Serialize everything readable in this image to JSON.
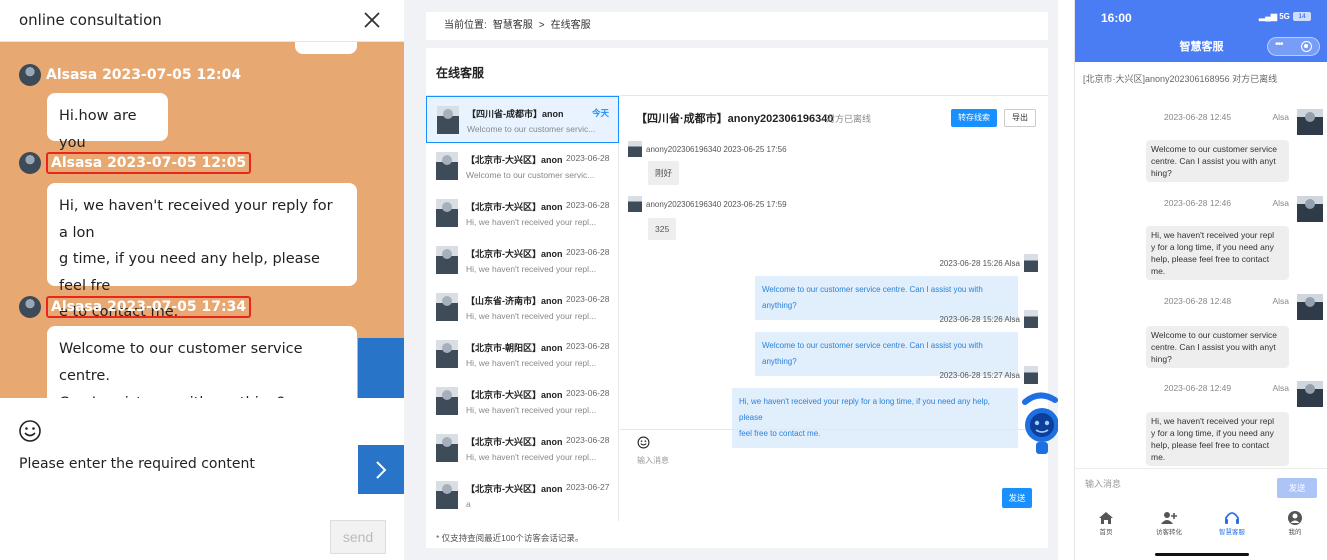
{
  "panel1": {
    "title": "online consultation",
    "messages": [
      {
        "meta": "Alsasa 2023-07-05 12:04",
        "text": "Hi.how are you"
      },
      {
        "meta": "Alsasa 2023-07-05 12:05",
        "text": "Hi, we haven't received your reply for a lon\ng time, if you need any help, please feel fre\ne to contact me."
      },
      {
        "meta": "Alsasa 2023-07-05 17:34",
        "text": "Welcome to our customer service centre.\nCan I assist you with anything?"
      }
    ],
    "input_placeholder": "Please enter the required content",
    "send_label": "send",
    "accent_color": "#2874c8",
    "highlight_color": "#e8261d"
  },
  "panel2": {
    "breadcrumb": {
      "prefix": "当前位置:",
      "parent": "智慧客服",
      "sep": ">",
      "current": "在线客服"
    },
    "section_title": "在线客服",
    "sessions": [
      {
        "loc": "【四川省-成都市】anon...",
        "date": "今天",
        "snippet": "Welcome to our customer servic..."
      },
      {
        "loc": "【北京市-大兴区】anon...",
        "date": "2023-06-28",
        "snippet": "Welcome to our customer servic..."
      },
      {
        "loc": "【北京市-大兴区】anon...",
        "date": "2023-06-28",
        "snippet": "Hi, we haven't received your repl..."
      },
      {
        "loc": "【北京市-大兴区】anon...",
        "date": "2023-06-28",
        "snippet": "Hi, we haven't received your repl..."
      },
      {
        "loc": "【山东省-济南市】anon...",
        "date": "2023-06-28",
        "snippet": "Hi, we haven't received your repl..."
      },
      {
        "loc": "【北京市-朝阳区】anon...",
        "date": "2023-06-28",
        "snippet": "Hi, we haven't received your repl..."
      },
      {
        "loc": "【北京市-大兴区】anon...",
        "date": "2023-06-28",
        "snippet": "Hi, we haven't received your repl..."
      },
      {
        "loc": "【北京市-大兴区】anon...",
        "date": "2023-06-28",
        "snippet": "Hi, we haven't received your repl..."
      },
      {
        "loc": "【北京市-大兴区】anon...",
        "date": "2023-06-27",
        "snippet": "a"
      }
    ],
    "chat_title": "【四川省·成都市】anony202306196340",
    "chat_status": "对方已离线",
    "save_label": "转存线索",
    "export_label": "导出",
    "visitor_msgs": [
      {
        "meta": "anony202306196340  2023-06-25 17:56",
        "text": "刚好"
      },
      {
        "meta": "anony202306196340  2023-06-25 17:59",
        "text": "325"
      }
    ],
    "agent_msgs": [
      {
        "meta": "2023-06-28 15:26  Alsa",
        "text": "Welcome to our customer service centre. Can I assist you with anything?"
      },
      {
        "meta": "2023-06-28 15:26  Alsa",
        "text": "Welcome to our customer service centre. Can I assist you with anything?"
      },
      {
        "meta": "2023-06-28 15:27  Alsa",
        "text": "Hi, we haven't received your reply for a long time, if you need any help, please\nfeel free to contact me."
      }
    ],
    "input_placeholder": "输入消息",
    "send_label": "发送",
    "footnote": "* 仅支持查阅最近100个访客会话记录。",
    "primary_color": "#1890ff"
  },
  "panel3": {
    "time": "16:00",
    "signal": "5G",
    "battery": "14",
    "app_title": "智慧客服",
    "header": "[北京市·大兴区]anony202306168956  对方已离线",
    "messages": [
      {
        "time": "2023-06-28 12:45",
        "name": "Alsa",
        "text": "Welcome to our customer service\ncentre. Can I assist you with anyt\nhing?"
      },
      {
        "time": "2023-06-28 12:46",
        "name": "Alsa",
        "text": "Hi, we haven't received your repl\ny for a long time, if you need any\nhelp, please feel free to contact\nme."
      },
      {
        "time": "2023-06-28 12:48",
        "name": "Alsa",
        "text": "Welcome to our customer service\ncentre. Can I assist you with anyt\nhing?"
      },
      {
        "time": "2023-06-28 12:49",
        "name": "Alsa",
        "text": "Hi, we haven't received your repl\ny for a long time, if you need any\nhelp, please feel free to contact\nme."
      }
    ],
    "input_placeholder": "输入消息",
    "send_label": "发送",
    "tabs": [
      "首页",
      "访客转化",
      "智慧客服",
      "我的"
    ],
    "brand_color": "#4a7df4"
  }
}
